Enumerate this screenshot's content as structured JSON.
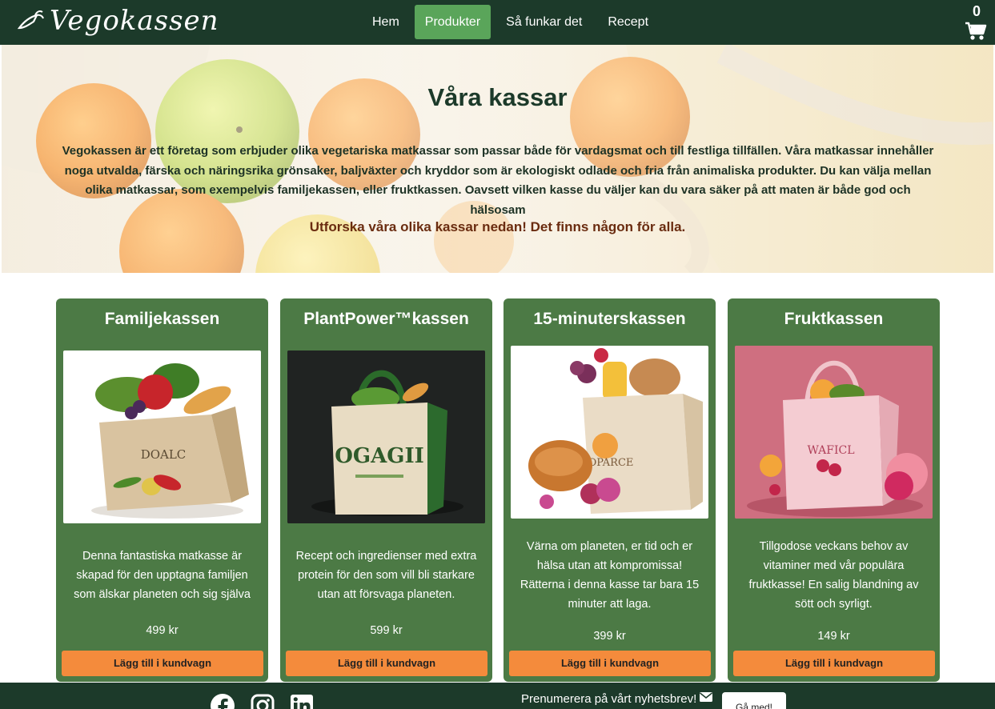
{
  "header": {
    "logo_text": "Vegokassen",
    "nav": [
      {
        "label": "Hem",
        "active": false
      },
      {
        "label": "Produkter",
        "active": true
      },
      {
        "label": "Så funkar det",
        "active": false
      },
      {
        "label": "Recept",
        "active": false
      }
    ],
    "cart_count": "0",
    "cart_icon": "shopping-cart-icon"
  },
  "hero": {
    "title": "Våra kassar",
    "text": "Vegokassen är ett företag som erbjuder olika vegetariska matkassar som passar både för vardagsmat och till festliga tillfällen. Våra matkassar innehåller noga utvalda, färska och näringsrika grönsaker, baljväxter och kryddor som är ekologiskt odlade och fria från animaliska produkter. Du kan välja mellan olika matkassar, som exempelvis familjekassen, eller fruktkassen. Oavsett vilken kasse du väljer kan du vara säker på att maten är både god och hälsosam",
    "cta": "Utforska våra olika kassar nedan! Det finns någon för alla."
  },
  "products": [
    {
      "title": "Familjekassen",
      "bag_print": "DOALC",
      "description": "Denna fantastiska matkasse är skapad för den upptagna familjen som älskar planeten och sig själva",
      "price": "499 kr",
      "button_label": "Lägg till i kundvagn"
    },
    {
      "title": "PlantPower™kassen",
      "bag_print": "OGAGII",
      "description": "Recept och ingredienser med extra protein för den som vill bli starkare utan att försvaga planeten.",
      "price": "599 kr",
      "button_label": "Lägg till i kundvagn"
    },
    {
      "title": "15-minuterskassen",
      "bag_print": "OPARCE",
      "description": "Värna om planeten, er tid och er hälsa utan att kompromissa! Rätterna i denna kasse tar bara 15 minuter att laga.",
      "price": "399 kr",
      "button_label": "Lägg till i kundvagn"
    },
    {
      "title": "Fruktkassen",
      "bag_print": "WAFICL",
      "description": "Tillgodose veckans behov av vitaminer med vår populära fruktkasse! En salig blandning av sött och syrligt.",
      "price": "149 kr",
      "button_label": "Lägg till i kundvagn"
    }
  ],
  "footer": {
    "social_icons": [
      "facebook-icon",
      "instagram-icon",
      "linkedin-icon"
    ],
    "newsletter_text": "Prenumerera på vårt nyhetsbrev!",
    "newsletter_icon": "envelope-icon",
    "newsletter_button": "Gå med!"
  },
  "colors": {
    "header_bg": "#1c3a2a",
    "nav_active": "#5aa55a",
    "card_bg": "#4c7a45",
    "button_orange": "#f48b3c",
    "hero_title": "#1c3a2a",
    "hero_cta": "#6a2c10"
  }
}
